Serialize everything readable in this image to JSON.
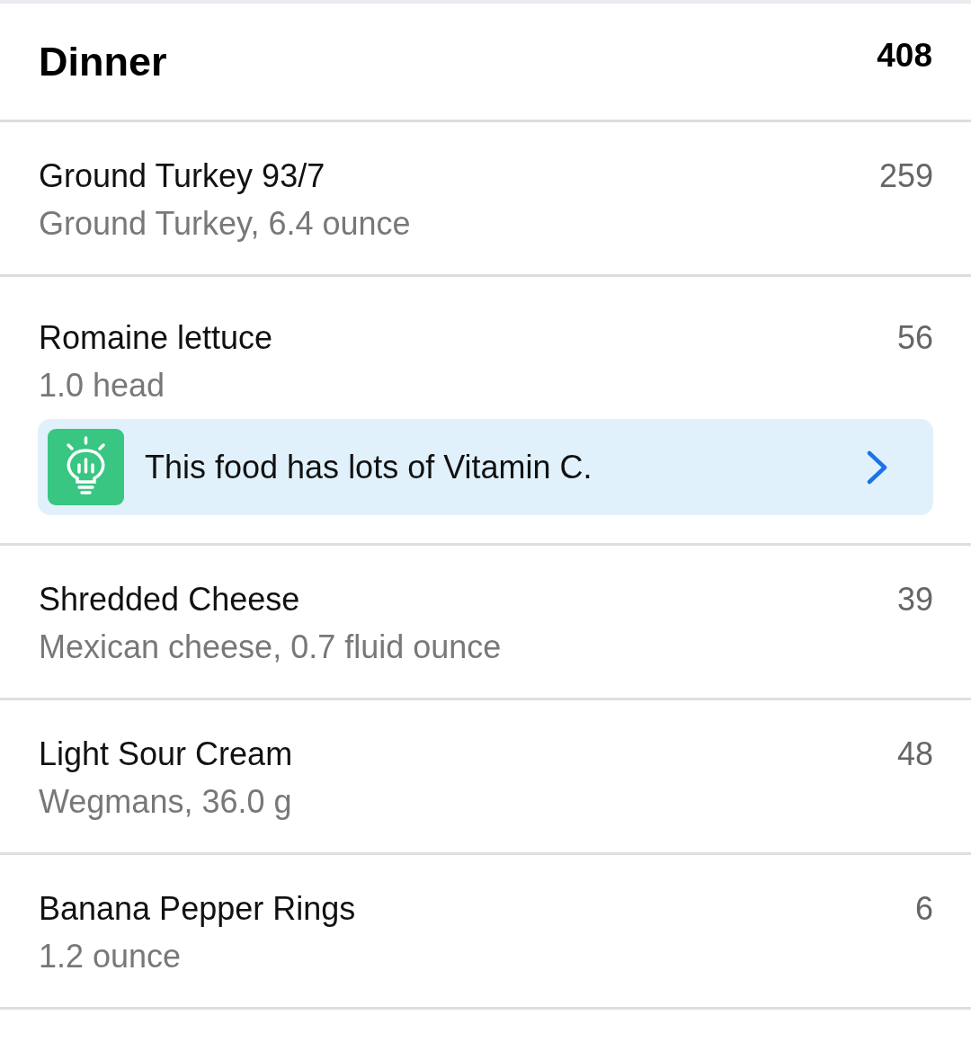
{
  "meal": {
    "title": "Dinner",
    "total": "408"
  },
  "foods": [
    {
      "name": "Ground Turkey 93/7",
      "detail": "Ground Turkey, 6.4 ounce",
      "calories": "259"
    },
    {
      "name": "Romaine lettuce",
      "detail": "1.0 head",
      "calories": "56",
      "tip": {
        "text": "This food has lots of Vitamin C."
      }
    },
    {
      "name": "Shredded Cheese",
      "detail": "Mexican cheese, 0.7 fluid ounce",
      "calories": "39"
    },
    {
      "name": "Light Sour Cream",
      "detail": "Wegmans, 36.0 g",
      "calories": "48"
    },
    {
      "name": "Banana Pepper Rings",
      "detail": "1.2 ounce",
      "calories": "6"
    }
  ]
}
